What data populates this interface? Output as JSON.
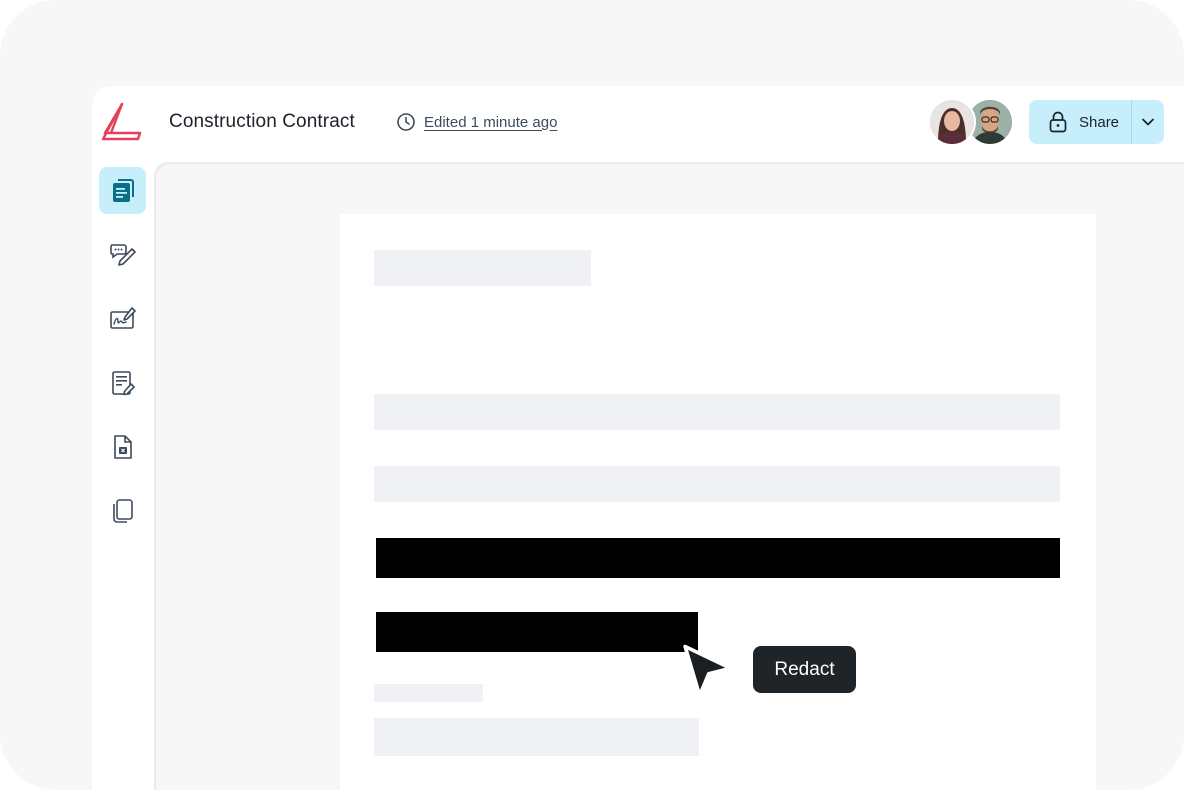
{
  "header": {
    "logo_icon": "brand-logo-icon",
    "title": "Construction Contract",
    "edited_label": "Edited 1 minute ago",
    "share_label": "Share"
  },
  "sidebar": {
    "items": [
      {
        "name": "documents",
        "icon": "documents-icon",
        "active": true
      },
      {
        "name": "comment-edit",
        "icon": "comment-pencil-icon",
        "active": false
      },
      {
        "name": "signature",
        "icon": "signature-icon",
        "active": false
      },
      {
        "name": "form-edit",
        "icon": "form-edit-icon",
        "active": false
      },
      {
        "name": "file-delete",
        "icon": "file-x-icon",
        "active": false
      },
      {
        "name": "copy",
        "icon": "copy-pages-icon",
        "active": false
      }
    ]
  },
  "tooltip": {
    "label": "Redact"
  },
  "colors": {
    "accent_bg": "#c7eefb",
    "icon_primary": "#0b6f8a",
    "brand": "#e3415b",
    "tooltip_bg": "#1f2428"
  }
}
